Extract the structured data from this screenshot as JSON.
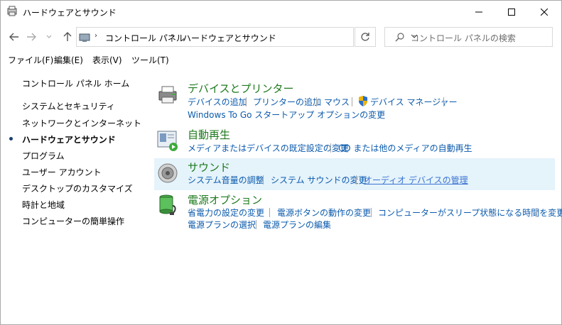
{
  "window": {
    "title": "ハードウェアとサウンド"
  },
  "nav": {
    "address_segments": [
      "コントロール パネル",
      "ハードウェアとサウンド"
    ],
    "search_placeholder": "コントロール パネルの検索"
  },
  "menu": [
    "ファイル(F)",
    "編集(E)",
    "表示(V)",
    "ツール(T)"
  ],
  "left_nav": {
    "home": "コントロール パネル ホーム",
    "items": [
      "システムとセキュリティ",
      "ネットワークとインターネット",
      "ハードウェアとサウンド",
      "プログラム",
      "ユーザー アカウント",
      "デスクトップのカスタマイズ",
      "時計と地域",
      "コンピューターの簡単操作"
    ],
    "current_index": 2
  },
  "categories": [
    {
      "title": "デバイスとプリンター",
      "icon": "printer-icon",
      "links": [
        "デバイスの追加",
        "プリンターの追加",
        "マウス",
        "デバイス マネージャー",
        "Windows To Go スタートアップ オプションの変更"
      ]
    },
    {
      "title": "自動再生",
      "icon": "autoplay-icon",
      "links": [
        "メディアまたはデバイスの既定設定の変更",
        "CD または他のメディアの自動再生"
      ]
    },
    {
      "title": "サウンド",
      "icon": "speaker-icon",
      "links": [
        "システム音量の調整",
        "システム サウンドの変更",
        "オーディオ デバイスの管理"
      ]
    },
    {
      "title": "電源オプション",
      "icon": "battery-icon",
      "links": [
        "省電力の設定の変更",
        "電源ボタンの動作の変更",
        "コンピューターがスリープ状態になる時間を変更",
        "電源プランの選択",
        "電源プランの編集"
      ]
    }
  ],
  "colors": {
    "link": "#0b5aad",
    "category_title": "#1e7a1e",
    "selected_bg": "#e5f3fb"
  }
}
